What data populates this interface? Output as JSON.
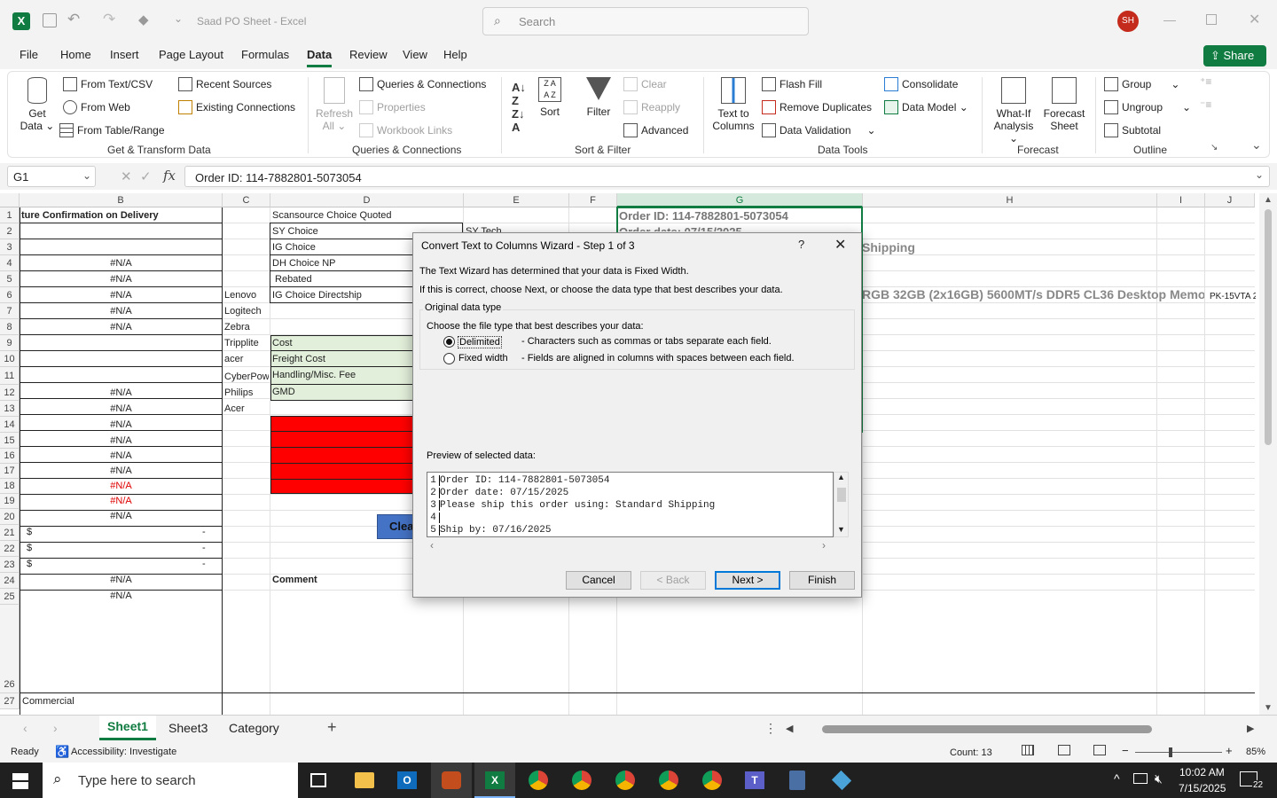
{
  "titlebar": {
    "title": "Saad PO Sheet  -  Excel",
    "search_placeholder": "Search",
    "avatar": "SH",
    "share": "Share"
  },
  "tabs": [
    "File",
    "Home",
    "Insert",
    "Page Layout",
    "Formulas",
    "Data",
    "Review",
    "View",
    "Help"
  ],
  "ribbon": {
    "get_data": "Get\nData",
    "get_data_l1": "Get",
    "get_data_l2": "Data ⌄",
    "from_text": "From Text/CSV",
    "from_web": "From Web",
    "from_table": "From Table/Range",
    "recent": "Recent Sources",
    "existing": "Existing Connections",
    "refresh_l1": "Refresh",
    "refresh_l2": "All ⌄",
    "queries": "Queries & Connections",
    "properties": "Properties",
    "workbook_links": "Workbook Links",
    "sort": "Sort",
    "filter": "Filter",
    "clear": "Clear",
    "reapply": "Reapply",
    "advanced": "Advanced",
    "ttc_l1": "Text to",
    "ttc_l2": "Columns",
    "flash": "Flash Fill",
    "remove_dup": "Remove Duplicates",
    "validation": "Data Validation",
    "consolidate": "Consolidate",
    "data_model": "Data Model ⌄",
    "whatif_l1": "What-If",
    "whatif_l2": "Analysis ⌄",
    "forecast_l1": "Forecast",
    "forecast_l2": "Sheet",
    "group": "Group",
    "ungroup": "Ungroup",
    "subtotal": "Subtotal",
    "groups": [
      "Get & Transform Data",
      "Queries & Connections",
      "Sort & Filter",
      "Data Tools",
      "Forecast",
      "Outline"
    ]
  },
  "formula": {
    "namebox": "G1",
    "fx": "fx",
    "content": "Order ID: 114-7882801-5073054"
  },
  "columns": [
    "B",
    "C",
    "D",
    "E",
    "F",
    "G",
    "H",
    "I",
    "J"
  ],
  "rows": [
    "1",
    "2",
    "3",
    "4",
    "5",
    "6",
    "7",
    "8",
    "9",
    "10",
    "11",
    "12",
    "13",
    "14",
    "15",
    "16",
    "17",
    "18",
    "19",
    "20",
    "21",
    "22",
    "23",
    "24",
    "25",
    "26",
    "27"
  ],
  "cells": {
    "b1": "ture Confirmation on Delivery",
    "na": "#N/A",
    "dollar": "$",
    "dash": "-",
    "commercial": "Commercial",
    "c": [
      "Lenovo",
      "Logitech",
      "Zebra",
      "Tripplite",
      "acer",
      "CyberPow",
      "Philips",
      "Acer"
    ],
    "d": [
      "Scansource Choice Quoted",
      "SY Choice",
      "IG Choice",
      "DH Choice NP",
      " Rebated",
      "IG Choice Directship",
      "",
      "Cost",
      "Freight Cost",
      "Handling/Misc. Fee",
      "GMD"
    ],
    "e2": "SY Tech",
    "comment": "Comment",
    "clear_btn": "Clea",
    "g1": "Order ID: 114-7882801-5073054",
    "g2": "Order date: 07/15/2025",
    "h3": "Shipping",
    "h6": "RGB 32GB (2x16GB) 5600MT/s DDR5 CL36 Desktop Memo",
    "i6": "PK-15VTA 2"
  },
  "sheets": [
    "Sheet1",
    "Sheet3",
    "Category"
  ],
  "status": {
    "ready": "Ready",
    "accessibility": "Accessibility: Investigate",
    "count": "Count: 13",
    "zoom": "85%"
  },
  "dialog": {
    "title": "Convert Text to Columns Wizard - Step 1 of 3",
    "help": "?",
    "line1": "The Text Wizard has determined that your data is Fixed Width.",
    "line2": "If this is correct, choose Next, or choose the data type that best describes your data.",
    "group_title": "Original data type",
    "choose": "Choose the file type that best describes your data:",
    "opt1": "Delimited",
    "opt1_desc": "- Characters such as commas or tabs separate each field.",
    "opt2": "Fixed width",
    "opt2_desc": "- Fields are aligned in columns with spaces between each field.",
    "preview_label": "Preview of selected data:",
    "preview": [
      {
        "n": "1",
        "t": "Order ID: 114-7882801-5073054"
      },
      {
        "n": "2",
        "t": "Order date: 07/15/2025"
      },
      {
        "n": "3",
        "t": "Please ship this order using: Standard Shipping"
      },
      {
        "n": "4",
        "t": ""
      },
      {
        "n": "5",
        "t": "Ship by: 07/16/2025"
      }
    ],
    "cancel": "Cancel",
    "back": "< Back",
    "next": "Next >",
    "finish": "Finish"
  },
  "taskbar": {
    "search": "Type here to search",
    "time": "10:02 AM",
    "date": "7/15/2025",
    "notif": "22"
  }
}
